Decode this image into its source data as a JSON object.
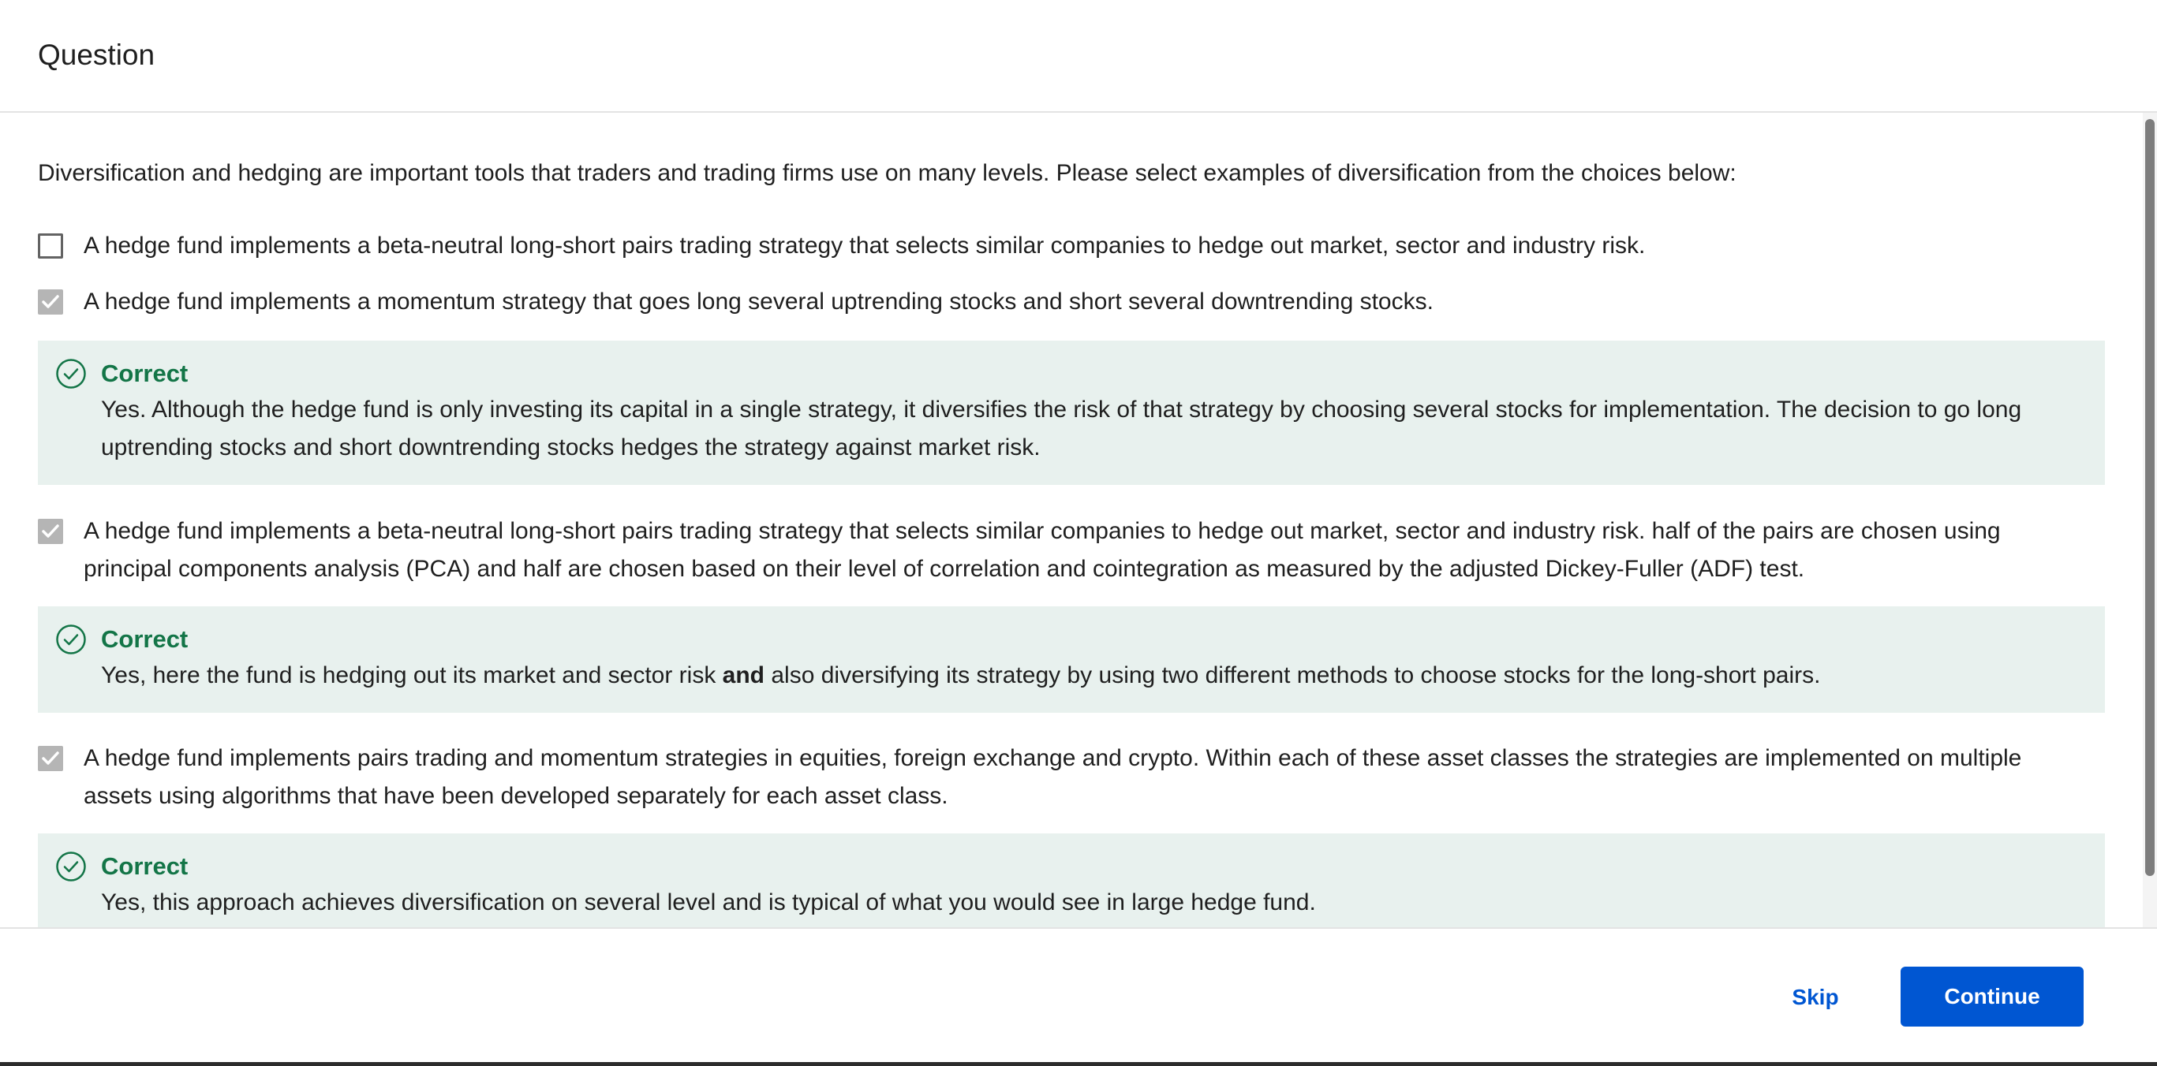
{
  "header": {
    "title": "Question"
  },
  "question": {
    "prompt": "Diversification and hedging are important tools that traders and trading firms use on many levels. Please select examples of diversification from the choices below:",
    "choices": [
      {
        "text": "A hedge fund implements a beta-neutral long-short pairs trading strategy that selects similar companies to hedge out market, sector and industry risk.",
        "checked": false
      },
      {
        "text": "A hedge fund implements a momentum strategy that goes long several uptrending stocks and short several downtrending stocks.",
        "checked": true,
        "feedback": {
          "title": "Correct",
          "text": "Yes. Although the hedge fund is only investing its capital in a single strategy, it diversifies the risk of that strategy by choosing several stocks for implementation. The decision to go long uptrending stocks and short downtrending stocks hedges the strategy against market risk."
        }
      },
      {
        "text": "A hedge fund implements a beta-neutral long-short pairs trading strategy that selects similar companies to hedge out market, sector and industry risk. half of the pairs are chosen using principal components analysis (PCA) and half are chosen based on their level of correlation and cointegration as measured by the adjusted Dickey-Fuller (ADF) test.",
        "checked": true,
        "feedback": {
          "title": "Correct",
          "text_before": "Yes, here the fund is hedging out its market and sector risk ",
          "text_bold": "and",
          "text_after": " also diversifying its strategy by using two different methods to choose stocks for the long-short pairs."
        }
      },
      {
        "text": "A hedge fund implements pairs trading and momentum strategies in equities, foreign exchange and crypto. Within each of these asset classes the strategies are implemented on multiple assets using algorithms that have been developed separately for each asset class.",
        "checked": true,
        "feedback": {
          "title": "Correct",
          "text": "Yes, this approach achieves diversification on several level and is typical of what you would see in large hedge fund."
        }
      }
    ]
  },
  "footer": {
    "skip_label": "Skip",
    "continue_label": "Continue"
  },
  "colors": {
    "accent": "#0056d2",
    "correct": "#137547",
    "feedback_bg": "#e8f1ee",
    "checked_box": "#b5b5b5"
  },
  "icons": {
    "check": "checkmark-icon",
    "correct": "check-circle-icon"
  }
}
